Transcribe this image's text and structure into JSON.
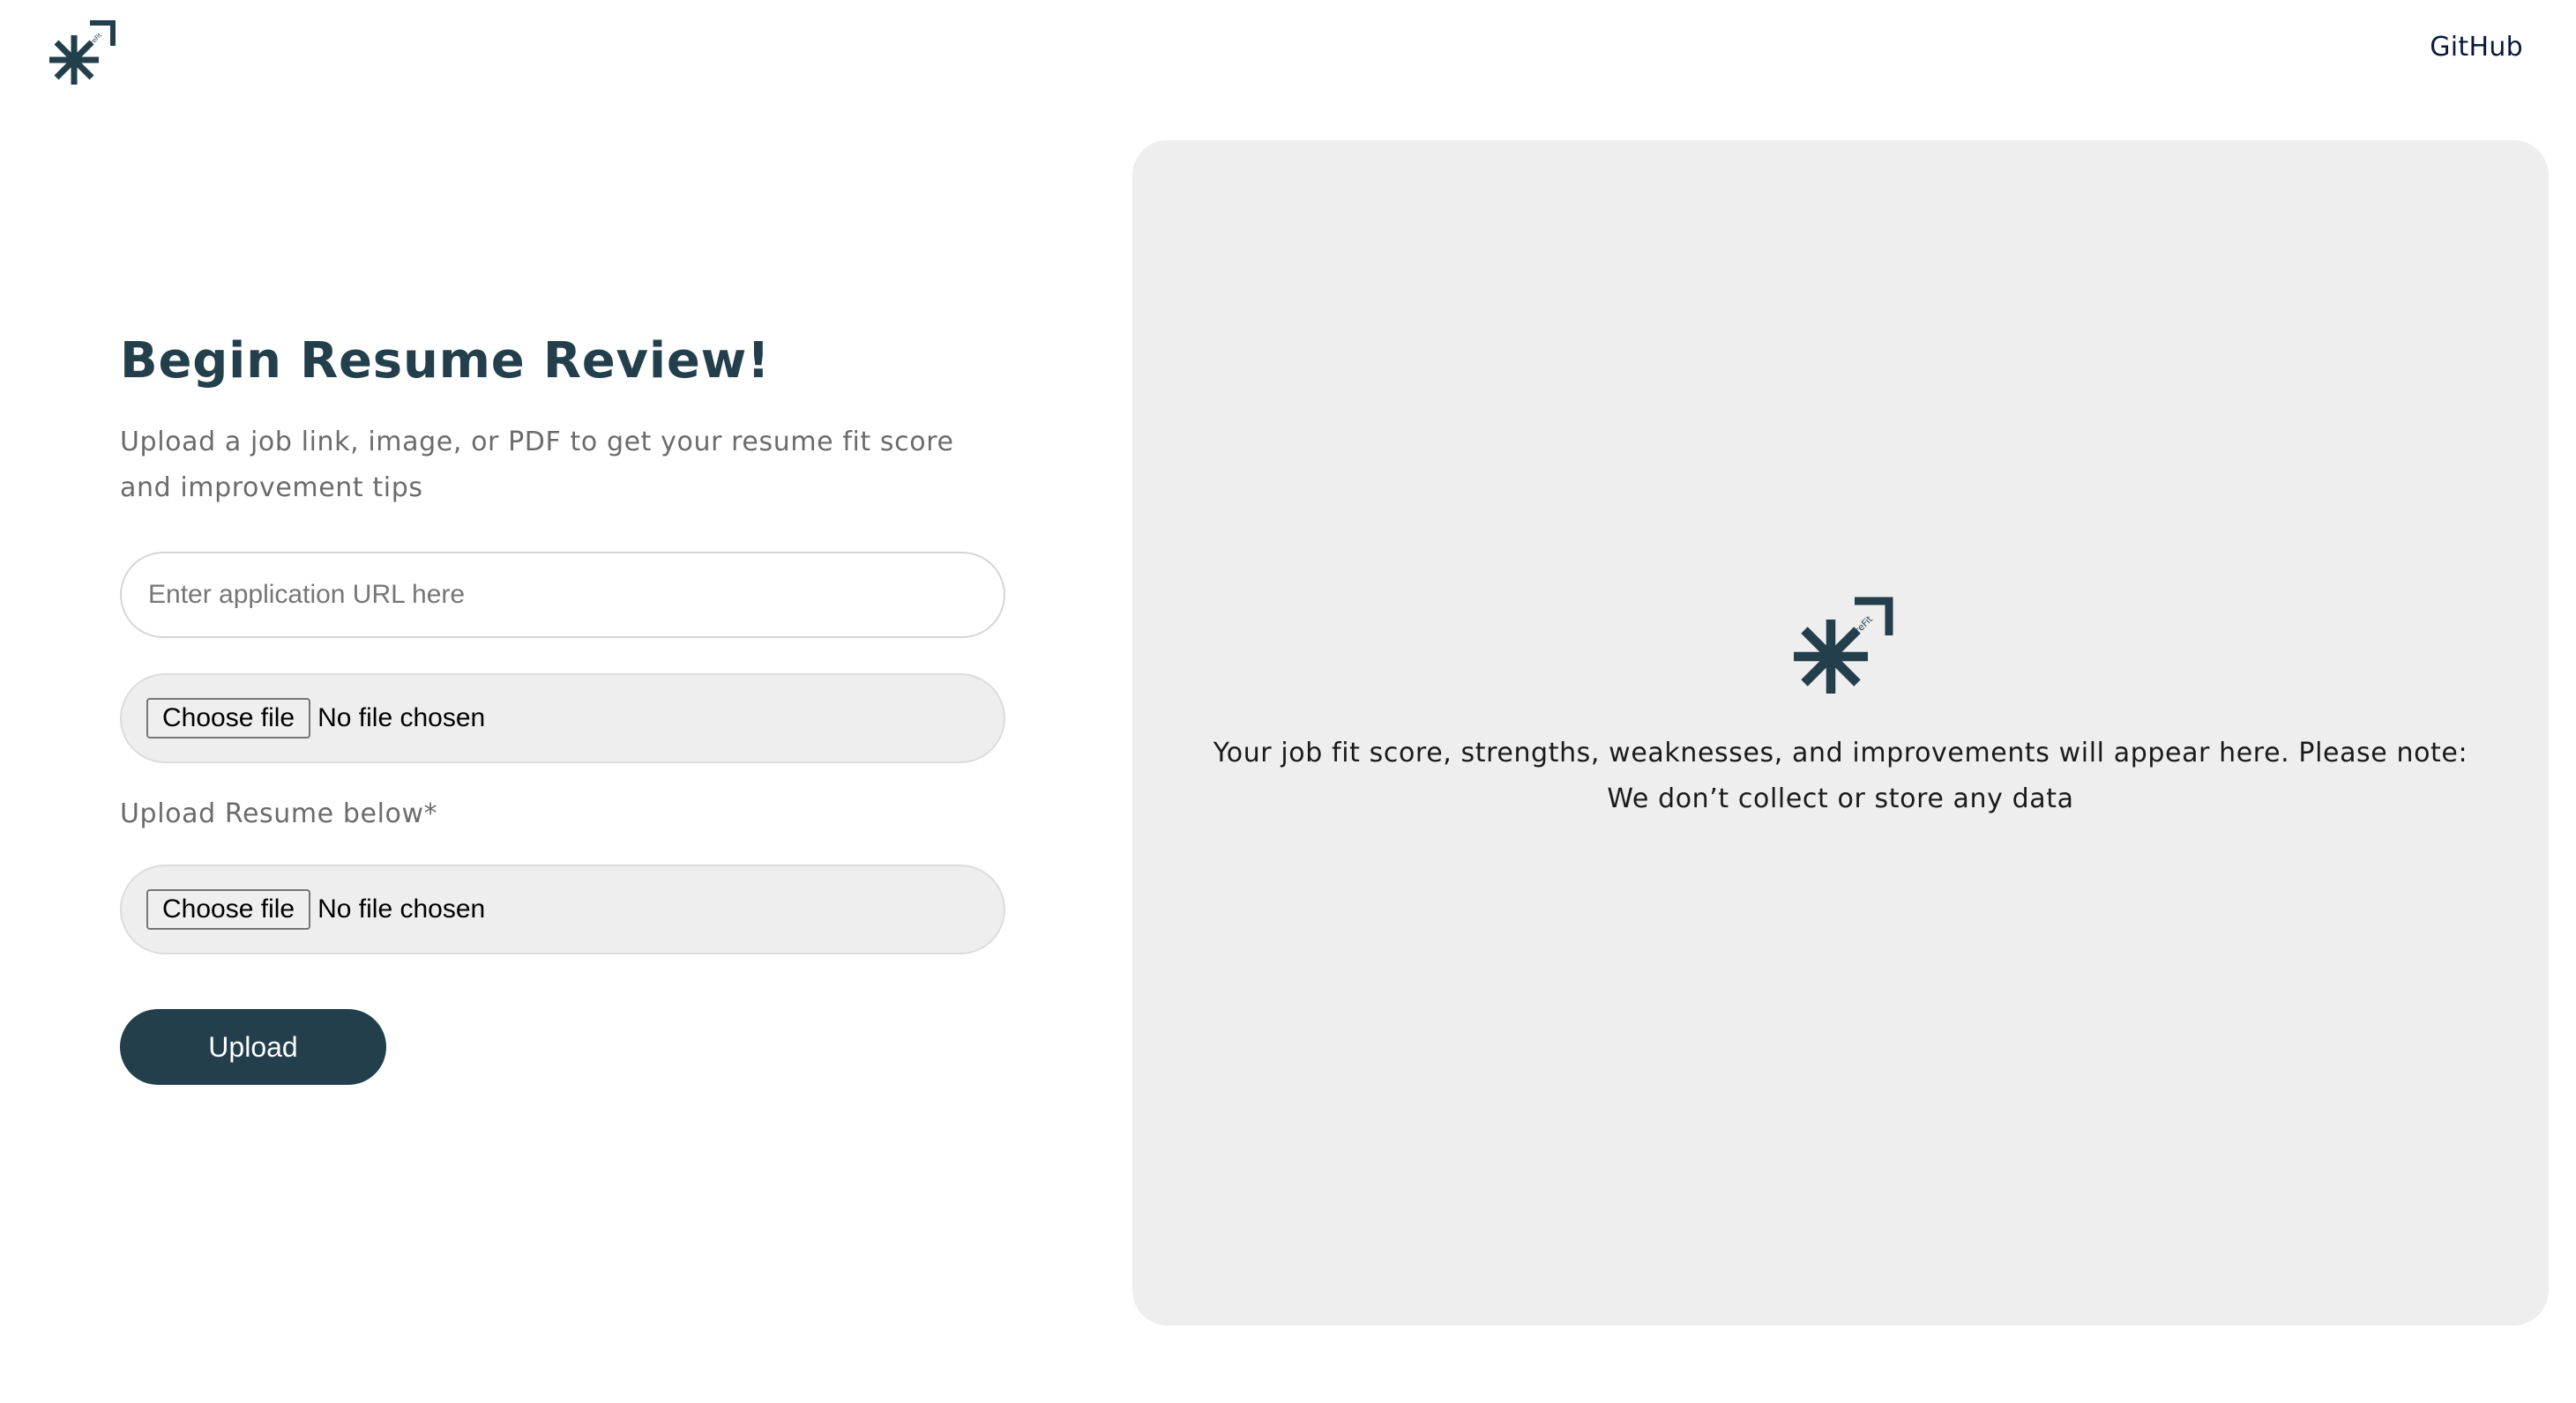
{
  "header": {
    "logo_text": "HireFit",
    "github_label": "GitHub"
  },
  "form": {
    "title": "Begin Resume Review!",
    "subtitle": "Upload a job link, image, or PDF to get your resume fit score and improvement tips",
    "url_placeholder": "Enter application URL here",
    "job_file": {
      "button_label": "Choose file",
      "status": "No file chosen"
    },
    "resume_label": "Upload Resume below*",
    "resume_file": {
      "button_label": "Choose file",
      "status": "No file chosen"
    },
    "upload_label": "Upload"
  },
  "results_panel": {
    "logo_text": "HireFit",
    "message_line1": "Your job fit score, strengths, weaknesses, and improvements will appear here. Please note:",
    "message_line2": "We don’t collect or store any data"
  },
  "colors": {
    "brand": "#243f4c",
    "panel_bg": "#eeeeee",
    "button_bg": "#233f4b"
  }
}
